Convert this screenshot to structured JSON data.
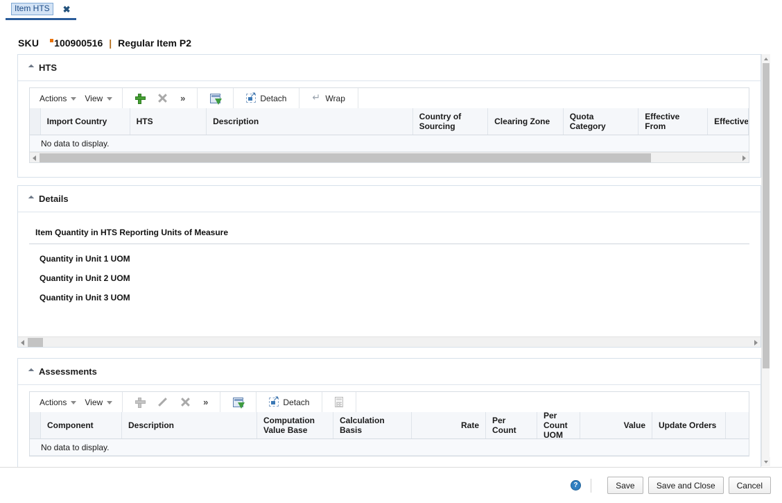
{
  "tab": {
    "label": "Item HTS",
    "close": "✖"
  },
  "header": {
    "sku_label": "SKU",
    "sku_value": "100900516",
    "separator": "|",
    "item_description": "Regular Item P2"
  },
  "hts_panel": {
    "title": "HTS",
    "toolbar": {
      "actions": "Actions",
      "view": "View",
      "more": "»",
      "detach": "Detach",
      "wrap": "Wrap",
      "add_icon": "plus-icon",
      "delete_icon": "delete-icon",
      "query_icon": "query-by-example-icon",
      "detach_icon": "detach-icon",
      "wrap_icon": "wrap-icon"
    },
    "columns": [
      "Import Country",
      "HTS",
      "Description",
      "Country of Sourcing",
      "Clearing Zone",
      "Quota Category",
      "Effective From",
      "Effective"
    ],
    "empty_message": "No data to display."
  },
  "details_panel": {
    "title": "Details",
    "section_title": "Item Quantity in HTS Reporting Units of Measure",
    "fields": [
      "Quantity in Unit 1 UOM",
      "Quantity in Unit 2 UOM",
      "Quantity in Unit 3 UOM"
    ]
  },
  "assessments_panel": {
    "title": "Assessments",
    "toolbar": {
      "actions": "Actions",
      "view": "View",
      "more": "»",
      "detach": "Detach",
      "add_icon": "plus-icon",
      "edit_icon": "edit-pencil-icon",
      "delete_icon": "delete-icon",
      "query_icon": "query-by-example-icon",
      "detach_icon": "detach-icon",
      "calculator_icon": "calculator-icon"
    },
    "columns": [
      "Component",
      "Description",
      "Computation Value Base",
      "Calculation Basis",
      "Rate",
      "Per Count",
      "Per Count UOM",
      "Value",
      "Update Orders"
    ],
    "empty_message": "No data to display."
  },
  "footer": {
    "help": "?",
    "save": "Save",
    "save_and_close": "Save and Close",
    "cancel": "Cancel"
  },
  "colors": {
    "tab_accent": "#2a5c9a",
    "tab_text": "#1c4b86",
    "changed_marker": "#e8730b",
    "panel_border": "#d6e0ea",
    "grid_header_bg": "#f5f7fa",
    "help_blue": "#2f7fc1"
  }
}
